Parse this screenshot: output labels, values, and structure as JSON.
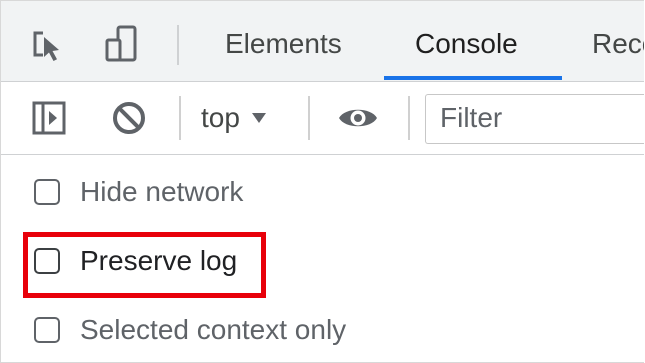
{
  "tabs": {
    "elements": "Elements",
    "console": "Console",
    "recorder": "Reco",
    "active": "console"
  },
  "toolbar": {
    "context": "top",
    "filter_placeholder": "Filter"
  },
  "settings": {
    "hide_network": "Hide network",
    "preserve_log": "Preserve log",
    "selected_context_only": "Selected context only"
  },
  "colors": {
    "accent": "#1a73e8",
    "highlight": "#e8000a",
    "tabbar_bg": "#f1f3f4"
  },
  "icons": {
    "inspect": "element-picker-icon",
    "device": "device-toolbar-icon",
    "sidebar": "sidebar-toggle-icon",
    "clear": "clear-console-icon",
    "eye": "live-expression-icon",
    "caret": "caret-down-icon"
  }
}
